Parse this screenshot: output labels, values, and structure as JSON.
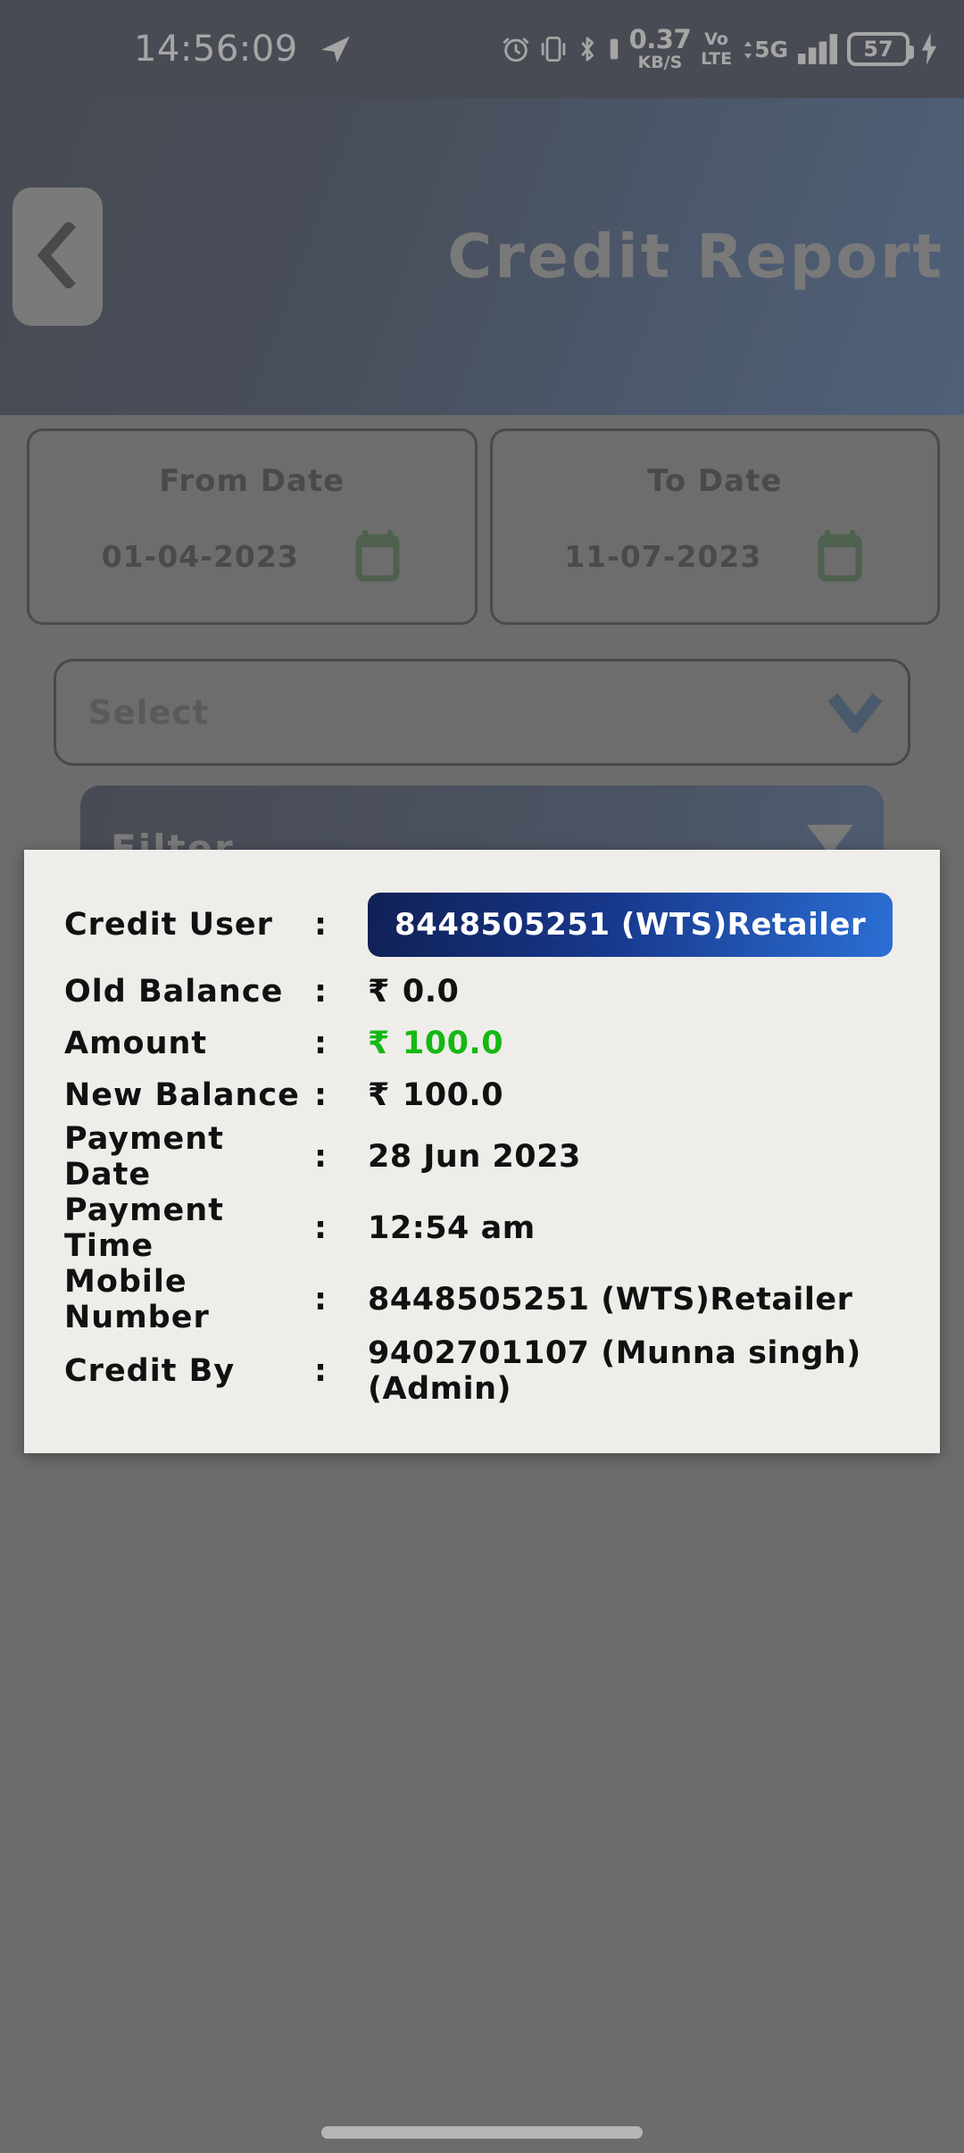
{
  "status_bar": {
    "time": "14:56:09",
    "telegram_icon": "telegram-icon",
    "alarm_icon": "alarm-icon",
    "vibrate_icon": "vibrate-icon",
    "bluetooth_icon": "bluetooth-icon",
    "net_speed_rate": "0.37",
    "net_speed_unit": "KB/S",
    "volte_line1": "Vo",
    "volte_line2": "LTE",
    "network_type": "5G",
    "signal_icon": "signal-bars-icon",
    "battery_level": "57",
    "charging_icon": "charging-bolt-icon"
  },
  "app_bar": {
    "title": "Credit Report",
    "back_icon": "chevron-left-icon"
  },
  "filters": {
    "from_date": {
      "label": "From Date",
      "value": "01-04-2023",
      "icon": "calendar-icon"
    },
    "to_date": {
      "label": "To Date",
      "value": "11-07-2023",
      "icon": "calendar-icon"
    },
    "select": {
      "value": "Select",
      "icon": "chevron-down-icon"
    },
    "filter_button": {
      "label": "Filter",
      "icon": "funnel-icon"
    }
  },
  "dialog": {
    "rows": [
      {
        "label": "Credit User",
        "value": "8448505251 (WTS)Retailer",
        "style": "chip"
      },
      {
        "label": "Old Balance",
        "currency": "₹",
        "value": "0.0",
        "style": "plain"
      },
      {
        "label": "Amount",
        "currency": "₹",
        "value": "100.0",
        "style": "green"
      },
      {
        "label": "New Balance",
        "currency": "₹",
        "value": "100.0",
        "style": "plain"
      },
      {
        "label": "Payment Date",
        "value": "28 Jun 2023",
        "style": "plain"
      },
      {
        "label": "Payment Time",
        "value": "12:54 am",
        "style": "plain"
      },
      {
        "label": "Mobile Number",
        "value": "8448505251 (WTS)Retailer",
        "style": "plain"
      },
      {
        "label": "Credit By",
        "value": "9402701107 (Munna singh)(Admin)",
        "style": "plain"
      }
    ],
    "colon": ":"
  },
  "colors": {
    "header_dark": "#0a1226",
    "header_light": "#1e4b8c",
    "chip_dark": "#102055",
    "chip_light": "#2b6fd4",
    "amount_green": "#14b814",
    "dialog_bg": "#efede9",
    "scrim": "#6e6e6e",
    "calendar_green": "#1b4a1b"
  },
  "system": {
    "home_indicator": "home-indicator"
  }
}
